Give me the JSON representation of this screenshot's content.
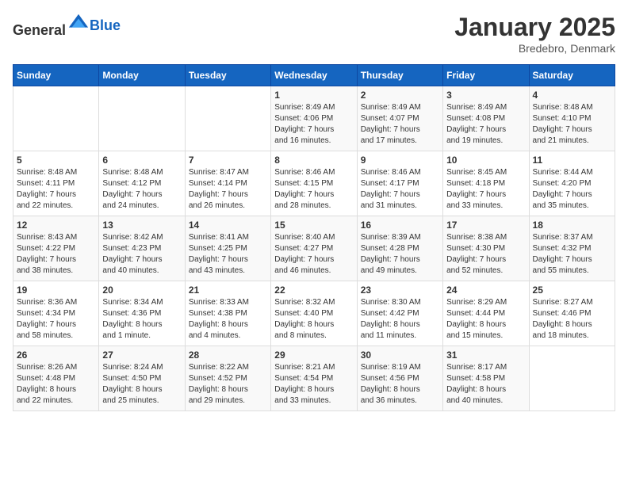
{
  "header": {
    "logo_general": "General",
    "logo_blue": "Blue",
    "month": "January 2025",
    "location": "Bredebro, Denmark"
  },
  "weekdays": [
    "Sunday",
    "Monday",
    "Tuesday",
    "Wednesday",
    "Thursday",
    "Friday",
    "Saturday"
  ],
  "weeks": [
    [
      {
        "day": "",
        "content": ""
      },
      {
        "day": "",
        "content": ""
      },
      {
        "day": "",
        "content": ""
      },
      {
        "day": "1",
        "content": "Sunrise: 8:49 AM\nSunset: 4:06 PM\nDaylight: 7 hours\nand 16 minutes."
      },
      {
        "day": "2",
        "content": "Sunrise: 8:49 AM\nSunset: 4:07 PM\nDaylight: 7 hours\nand 17 minutes."
      },
      {
        "day": "3",
        "content": "Sunrise: 8:49 AM\nSunset: 4:08 PM\nDaylight: 7 hours\nand 19 minutes."
      },
      {
        "day": "4",
        "content": "Sunrise: 8:48 AM\nSunset: 4:10 PM\nDaylight: 7 hours\nand 21 minutes."
      }
    ],
    [
      {
        "day": "5",
        "content": "Sunrise: 8:48 AM\nSunset: 4:11 PM\nDaylight: 7 hours\nand 22 minutes."
      },
      {
        "day": "6",
        "content": "Sunrise: 8:48 AM\nSunset: 4:12 PM\nDaylight: 7 hours\nand 24 minutes."
      },
      {
        "day": "7",
        "content": "Sunrise: 8:47 AM\nSunset: 4:14 PM\nDaylight: 7 hours\nand 26 minutes."
      },
      {
        "day": "8",
        "content": "Sunrise: 8:46 AM\nSunset: 4:15 PM\nDaylight: 7 hours\nand 28 minutes."
      },
      {
        "day": "9",
        "content": "Sunrise: 8:46 AM\nSunset: 4:17 PM\nDaylight: 7 hours\nand 31 minutes."
      },
      {
        "day": "10",
        "content": "Sunrise: 8:45 AM\nSunset: 4:18 PM\nDaylight: 7 hours\nand 33 minutes."
      },
      {
        "day": "11",
        "content": "Sunrise: 8:44 AM\nSunset: 4:20 PM\nDaylight: 7 hours\nand 35 minutes."
      }
    ],
    [
      {
        "day": "12",
        "content": "Sunrise: 8:43 AM\nSunset: 4:22 PM\nDaylight: 7 hours\nand 38 minutes."
      },
      {
        "day": "13",
        "content": "Sunrise: 8:42 AM\nSunset: 4:23 PM\nDaylight: 7 hours\nand 40 minutes."
      },
      {
        "day": "14",
        "content": "Sunrise: 8:41 AM\nSunset: 4:25 PM\nDaylight: 7 hours\nand 43 minutes."
      },
      {
        "day": "15",
        "content": "Sunrise: 8:40 AM\nSunset: 4:27 PM\nDaylight: 7 hours\nand 46 minutes."
      },
      {
        "day": "16",
        "content": "Sunrise: 8:39 AM\nSunset: 4:28 PM\nDaylight: 7 hours\nand 49 minutes."
      },
      {
        "day": "17",
        "content": "Sunrise: 8:38 AM\nSunset: 4:30 PM\nDaylight: 7 hours\nand 52 minutes."
      },
      {
        "day": "18",
        "content": "Sunrise: 8:37 AM\nSunset: 4:32 PM\nDaylight: 7 hours\nand 55 minutes."
      }
    ],
    [
      {
        "day": "19",
        "content": "Sunrise: 8:36 AM\nSunset: 4:34 PM\nDaylight: 7 hours\nand 58 minutes."
      },
      {
        "day": "20",
        "content": "Sunrise: 8:34 AM\nSunset: 4:36 PM\nDaylight: 8 hours\nand 1 minute."
      },
      {
        "day": "21",
        "content": "Sunrise: 8:33 AM\nSunset: 4:38 PM\nDaylight: 8 hours\nand 4 minutes."
      },
      {
        "day": "22",
        "content": "Sunrise: 8:32 AM\nSunset: 4:40 PM\nDaylight: 8 hours\nand 8 minutes."
      },
      {
        "day": "23",
        "content": "Sunrise: 8:30 AM\nSunset: 4:42 PM\nDaylight: 8 hours\nand 11 minutes."
      },
      {
        "day": "24",
        "content": "Sunrise: 8:29 AM\nSunset: 4:44 PM\nDaylight: 8 hours\nand 15 minutes."
      },
      {
        "day": "25",
        "content": "Sunrise: 8:27 AM\nSunset: 4:46 PM\nDaylight: 8 hours\nand 18 minutes."
      }
    ],
    [
      {
        "day": "26",
        "content": "Sunrise: 8:26 AM\nSunset: 4:48 PM\nDaylight: 8 hours\nand 22 minutes."
      },
      {
        "day": "27",
        "content": "Sunrise: 8:24 AM\nSunset: 4:50 PM\nDaylight: 8 hours\nand 25 minutes."
      },
      {
        "day": "28",
        "content": "Sunrise: 8:22 AM\nSunset: 4:52 PM\nDaylight: 8 hours\nand 29 minutes."
      },
      {
        "day": "29",
        "content": "Sunrise: 8:21 AM\nSunset: 4:54 PM\nDaylight: 8 hours\nand 33 minutes."
      },
      {
        "day": "30",
        "content": "Sunrise: 8:19 AM\nSunset: 4:56 PM\nDaylight: 8 hours\nand 36 minutes."
      },
      {
        "day": "31",
        "content": "Sunrise: 8:17 AM\nSunset: 4:58 PM\nDaylight: 8 hours\nand 40 minutes."
      },
      {
        "day": "",
        "content": ""
      }
    ]
  ]
}
